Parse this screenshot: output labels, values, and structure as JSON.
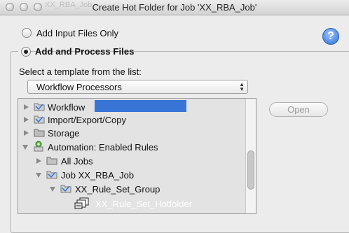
{
  "window": {
    "title": "Create Hot Folder for Job 'XX_RBA_Job'",
    "ghost_title": "XX_RBA_Job"
  },
  "options": {
    "input_only_label": "Add Input Files Only",
    "process_label": "Add and Process Files",
    "selected": "process"
  },
  "help": {
    "glyph": "?"
  },
  "template": {
    "prompt": "Select a template from the list:",
    "selected_value": "Workflow Processors"
  },
  "tree": {
    "items": [
      {
        "label": "Workflow",
        "icon": "folder-icon",
        "expanded": false
      },
      {
        "label": "Import/Export/Copy",
        "icon": "folder-icon",
        "expanded": false
      },
      {
        "label": "Storage",
        "icon": "folder-icon",
        "expanded": false
      },
      {
        "label": "Automation: Enabled Rules",
        "icon": "automation-icon",
        "expanded": true
      },
      {
        "label": "All Jobs",
        "icon": "folder-icon",
        "expanded": false
      },
      {
        "label": "Job XX_RBA_Job",
        "icon": "folder-icon",
        "expanded": true
      },
      {
        "label": "XX_Rule_Set_Group",
        "icon": "folder-icon",
        "expanded": true
      },
      {
        "label": "XX_Rule_Set_Hotfolder",
        "icon": "hotfolder-icon",
        "selected": true
      }
    ],
    "scroll_position": 0.55
  },
  "buttons": {
    "open_label": "Open"
  },
  "colors": {
    "selection": "#3875d7",
    "help_blue": "#2f6fd6"
  }
}
